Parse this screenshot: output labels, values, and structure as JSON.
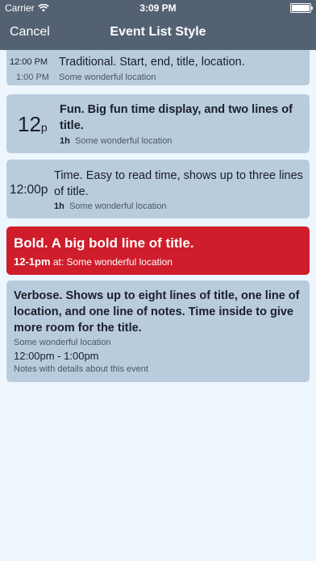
{
  "status_bar": {
    "carrier": "Carrier",
    "time": "3:09 PM"
  },
  "nav": {
    "cancel_label": "Cancel",
    "title": "Event List Style"
  },
  "styles": [
    {
      "start": "12:00 PM",
      "end": "1:00 PM",
      "title": "Traditional.  Start, end, title, location.",
      "location": "Some wonderful location"
    },
    {
      "big_time": "12",
      "ampm": "p",
      "title": "Fun.  Big fun time display, and two lines of title.",
      "duration": "1h",
      "location": "Some wonderful location"
    },
    {
      "time": "12:00p",
      "title": "Time.  Easy to read time, shows up to three lines of title.",
      "duration": "1h",
      "location": "Some wonderful location"
    },
    {
      "title": "Bold.  A big bold line of title.",
      "time_range": "12-1pm",
      "location": "at: Some wonderful location",
      "background": "#cf1d2b"
    },
    {
      "title": "Verbose.  Shows up to eight lines of title, one line of location, and one line of notes.  Time inside to give more room for the title.",
      "location": "Some wonderful location",
      "time_range": "12:00pm - 1:00pm",
      "notes": "Notes with details about this event"
    }
  ],
  "colors": {
    "bar": "#546173",
    "card": "#b9ccde",
    "background": "#eef6fd"
  }
}
